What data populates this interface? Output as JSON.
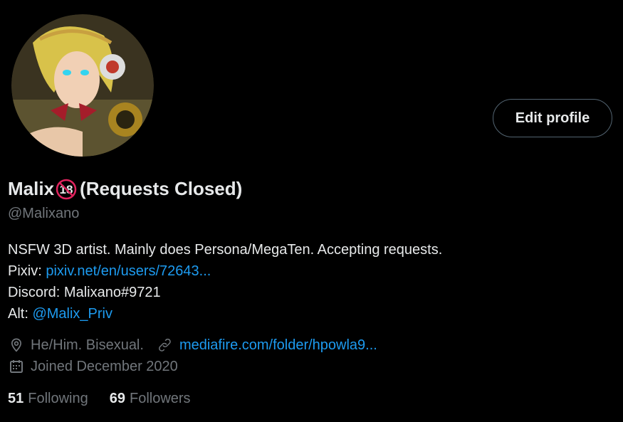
{
  "profile": {
    "display_name": "Malix",
    "name_badge": "18",
    "name_suffix": "(Requests Closed)",
    "handle": "@Malixano",
    "edit_button": "Edit profile"
  },
  "bio": {
    "line1": "NSFW 3D artist. Mainly does Persona/MegaTen. Accepting requests.",
    "pixiv_label": "Pixiv: ",
    "pixiv_link": "pixiv.net/en/users/72643...",
    "discord": "Discord: Malixano#9721",
    "alt_label": "Alt: ",
    "alt_link": "@Malix_Priv"
  },
  "meta": {
    "location_icon": "location-pin-icon",
    "location": "He/Him. Bisexual.",
    "link_icon": "link-icon",
    "website": "mediafire.com/folder/hpowla9...",
    "calendar_icon": "calendar-icon",
    "joined": "Joined December 2020"
  },
  "stats": {
    "following_count": "51",
    "following_label": "Following",
    "followers_count": "69",
    "followers_label": "Followers"
  },
  "colors": {
    "background": "#000000",
    "text_primary": "#e7e9ea",
    "text_secondary": "#71767b",
    "link": "#1d9bf0",
    "button_border": "#536471",
    "prohibition_red": "#e0245e"
  }
}
